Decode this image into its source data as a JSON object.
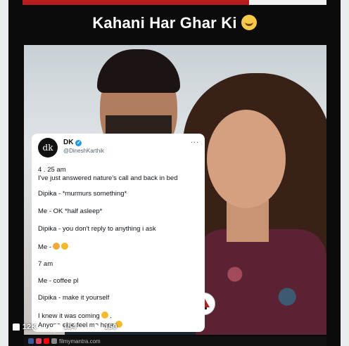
{
  "headline": {
    "text": "Kahani Har Ghar Ki",
    "emoji": "laughing-tears-emoji"
  },
  "tweet": {
    "avatar_text": "dk",
    "name": "DK",
    "handle": "@DineshKarthik",
    "more": "...",
    "lines": [
      "4 . 25 am",
      "I've just answered nature's call and back in bed",
      "Dipika - *murmurs something*",
      "Me - OK  *half asleep*",
      "Dipika - you don't reply to anything i ask",
      "Me -",
      "7 am",
      "Me - coffee pl",
      "Dipika - make it yourself",
      "I knew it was coming",
      "Anyone else feel me here"
    ]
  },
  "reactions": {
    "likes": "12K",
    "comments": "154",
    "shares": "150"
  },
  "footer": {
    "site": "filmymantra.com"
  },
  "colors": {
    "accent": "#b81d1d",
    "verified": "#1d9bf0"
  }
}
